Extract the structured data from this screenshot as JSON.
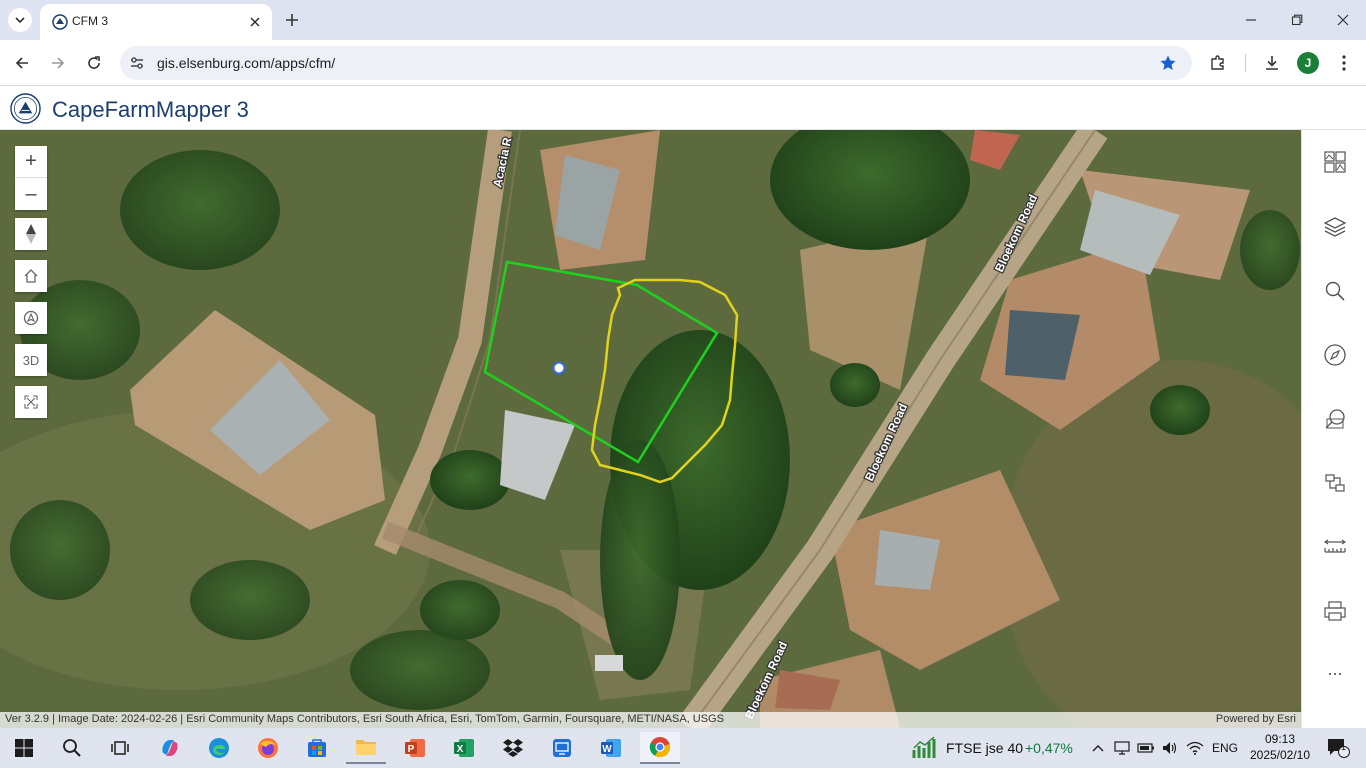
{
  "browser": {
    "tab_title": "CFM 3",
    "url": "gis.elsenburg.com/apps/cfm/",
    "profile_initial": "J"
  },
  "app": {
    "title": "CapeFarmMapper 3"
  },
  "map": {
    "roads": {
      "acacia": "Acacia R",
      "bloekom_1": "Bloekom Road",
      "bloekom_2": "Bloekom Road",
      "bloekom_3": "Bloekom Road"
    },
    "controls": {
      "zoom_in": "+",
      "zoom_out": "–",
      "three_d": "3D"
    },
    "attribution": "Ver 3.2.9 | Image Date: 2024-02-26 | Esri Community Maps Contributors, Esri South Africa, Esri, TomTom, Garmin, Foursquare, METI/NASA, USGS",
    "powered_by": "Powered by Esri",
    "colors": {
      "property_boundary": "#1fd11f",
      "drawn_area": "#e3d21a"
    }
  },
  "right_panel": {
    "more": "..."
  },
  "taskbar": {
    "ftse_label": "FTSE jse 40",
    "ftse_change": "+0,47%",
    "language": "ENG",
    "time": "09:13",
    "date": "2025/02/10",
    "notification_count": "1"
  }
}
